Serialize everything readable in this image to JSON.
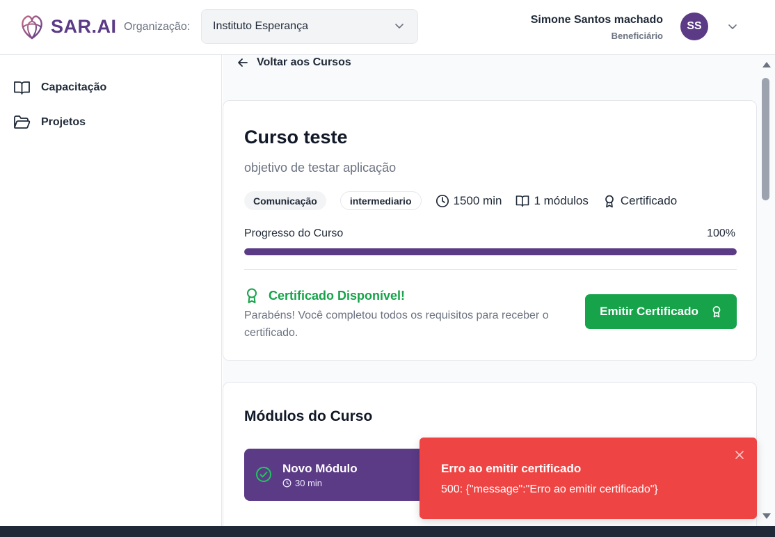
{
  "header": {
    "logo_text": "SAR.AI",
    "org_label": "Organização:",
    "org_selected": "Instituto Esperança",
    "user_name": "Simone Santos machado",
    "user_role": "Beneficiário",
    "avatar_initials": "SS"
  },
  "sidebar": {
    "items": [
      {
        "label": "Capacitação",
        "icon": "book-open-icon"
      },
      {
        "label": "Projetos",
        "icon": "folder-open-icon"
      }
    ]
  },
  "main": {
    "back_label": "Voltar aos Cursos",
    "course": {
      "title": "Curso teste",
      "subtitle": "objetivo de testar aplicação",
      "tags": [
        "Comunicação",
        "intermediario"
      ],
      "duration": "1500 min",
      "modules_count": "1 módulos",
      "certificate_label": "Certificado",
      "progress_label": "Progresso do Curso",
      "progress_text": "100%",
      "progress_value": 1.0
    },
    "certificate": {
      "title": "Certificado Disponível!",
      "text": "Parabéns! Você completou todos os requisitos para receber o certificado.",
      "button_label": "Emitir Certificado"
    },
    "modules_section": {
      "heading": "Módulos do Curso",
      "modules": [
        {
          "name": "Novo Módulo",
          "duration": "30 min",
          "completed": true
        }
      ]
    }
  },
  "toast": {
    "title": "Erro ao emitir certificado",
    "message": "500: {\"message\":\"Erro ao emitir certificado\"}"
  },
  "colors": {
    "brand": "#5b3a86",
    "success": "#16a34a",
    "error": "#ef4444"
  }
}
